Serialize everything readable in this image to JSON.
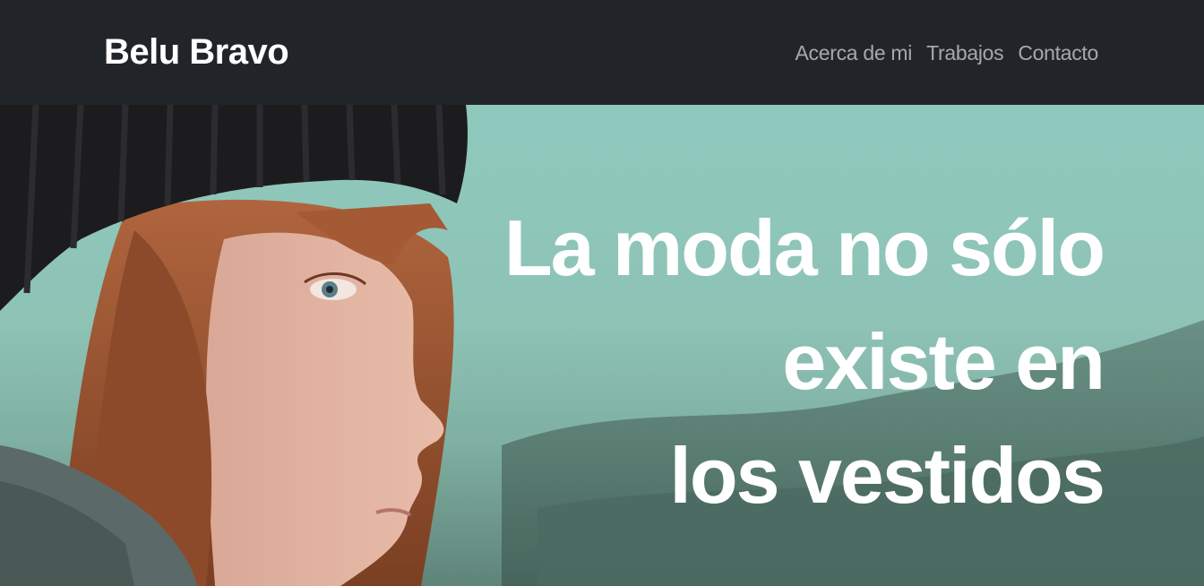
{
  "navbar": {
    "brand": "Belu Bravo",
    "links": [
      {
        "label": "Acerca de mi"
      },
      {
        "label": "Trabajos"
      },
      {
        "label": "Contacto"
      }
    ]
  },
  "hero": {
    "headline_lines": [
      "La moda no sólo",
      "existe en",
      "los vestidos"
    ],
    "image": "woman-in-black-beanie-photo"
  },
  "colors": {
    "navbar_bg": "#212529",
    "hero_sky": "#8fc9bd",
    "headline": "#ffffff",
    "nav_link": "rgba(255,255,255,0.6)"
  }
}
